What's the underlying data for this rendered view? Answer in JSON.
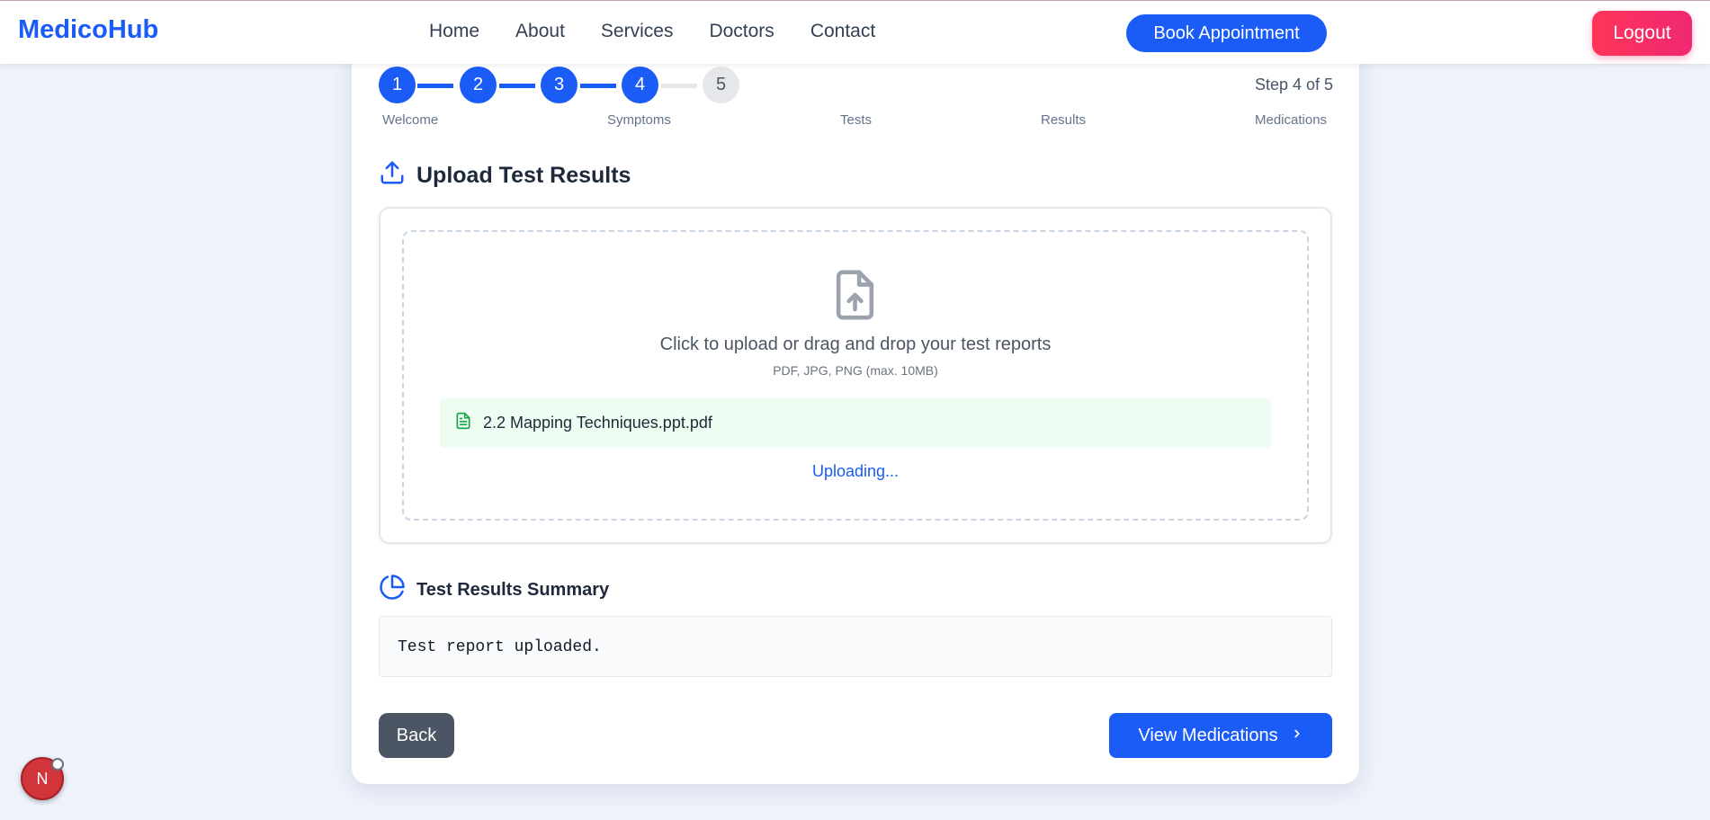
{
  "navbar": {
    "brand": "MedicoHub",
    "links": [
      "Home",
      "About",
      "Services",
      "Doctors",
      "Contact"
    ],
    "book_label": "Book Appointment",
    "logout_label": "Logout"
  },
  "stepper": {
    "steps": [
      "1",
      "2",
      "3",
      "4",
      "5"
    ],
    "current": 4,
    "total": 5,
    "step_count_text": "Step 4 of 5",
    "labels": [
      "Welcome",
      "Symptoms",
      "Tests",
      "Results",
      "Medications"
    ]
  },
  "upload": {
    "title": "Upload Test Results",
    "main_text": "Click to upload or drag and drop your test reports",
    "sub_text": "PDF, JPG, PNG (max. 10MB)",
    "file_name": "2.2 Mapping Techniques.ppt.pdf",
    "status": "Uploading..."
  },
  "summary": {
    "title": "Test Results Summary",
    "text": "Test report uploaded."
  },
  "actions": {
    "back_label": "Back",
    "next_label": "View Medications"
  },
  "fab": {
    "letter": "N"
  },
  "colors": {
    "primary": "#1a5cf5",
    "logout_gradient_start": "#ff3458",
    "logout_gradient_end": "#ef2873",
    "back_button": "#4b5563",
    "file_row_bg": "#eefcf2",
    "file_icon": "#16a34a"
  }
}
